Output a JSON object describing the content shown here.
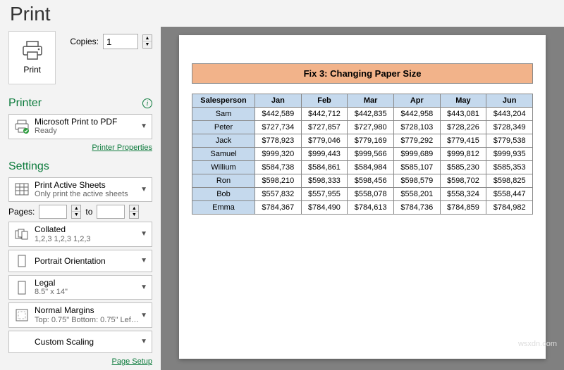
{
  "header": {
    "title": "Print"
  },
  "print_button": {
    "label": "Print"
  },
  "copies": {
    "label": "Copies:",
    "value": "1"
  },
  "printer": {
    "section": "Printer",
    "name": "Microsoft Print to PDF",
    "status": "Ready",
    "properties_link": "Printer Properties"
  },
  "settings": {
    "section": "Settings",
    "print_what": {
      "title": "Print Active Sheets",
      "sub": "Only print the active sheets"
    },
    "pages": {
      "label": "Pages:",
      "to": "to",
      "from": "",
      "until": ""
    },
    "collation": {
      "title": "Collated",
      "sub": "1,2,3   1,2,3   1,2,3"
    },
    "orientation": {
      "title": "Portrait Orientation"
    },
    "paper": {
      "title": "Legal",
      "sub": "8.5\" x 14\""
    },
    "margins": {
      "title": "Normal Margins",
      "sub": "Top: 0.75\" Bottom: 0.75\" Lef…"
    },
    "scaling": {
      "title": "Custom Scaling"
    },
    "page_setup_link": "Page Setup"
  },
  "document": {
    "title": "Fix 3: Changing Paper Size",
    "headers": [
      "Salesperson",
      "Jan",
      "Feb",
      "Mar",
      "Apr",
      "May",
      "Jun"
    ],
    "rows": [
      [
        "Sam",
        "$442,589",
        "$442,712",
        "$442,835",
        "$442,958",
        "$443,081",
        "$443,204"
      ],
      [
        "Peter",
        "$727,734",
        "$727,857",
        "$727,980",
        "$728,103",
        "$728,226",
        "$728,349"
      ],
      [
        "Jack",
        "$778,923",
        "$779,046",
        "$779,169",
        "$779,292",
        "$779,415",
        "$779,538"
      ],
      [
        "Samuel",
        "$999,320",
        "$999,443",
        "$999,566",
        "$999,689",
        "$999,812",
        "$999,935"
      ],
      [
        "Willium",
        "$584,738",
        "$584,861",
        "$584,984",
        "$585,107",
        "$585,230",
        "$585,353"
      ],
      [
        "Ron",
        "$598,210",
        "$598,333",
        "$598,456",
        "$598,579",
        "$598,702",
        "$598,825"
      ],
      [
        "Bob",
        "$557,832",
        "$557,955",
        "$558,078",
        "$558,201",
        "$558,324",
        "$558,447"
      ],
      [
        "Emma",
        "$784,367",
        "$784,490",
        "$784,613",
        "$784,736",
        "$784,859",
        "$784,982"
      ]
    ]
  },
  "watermark": "wsxdn.com",
  "chart_data": {
    "type": "table",
    "title": "Fix 3: Changing Paper Size",
    "columns": [
      "Salesperson",
      "Jan",
      "Feb",
      "Mar",
      "Apr",
      "May",
      "Jun"
    ],
    "rows": [
      {
        "Salesperson": "Sam",
        "Jan": 442589,
        "Feb": 442712,
        "Mar": 442835,
        "Apr": 442958,
        "May": 443081,
        "Jun": 443204
      },
      {
        "Salesperson": "Peter",
        "Jan": 727734,
        "Feb": 727857,
        "Mar": 727980,
        "Apr": 728103,
        "May": 728226,
        "Jun": 728349
      },
      {
        "Salesperson": "Jack",
        "Jan": 778923,
        "Feb": 779046,
        "Mar": 779169,
        "Apr": 779292,
        "May": 779415,
        "Jun": 779538
      },
      {
        "Salesperson": "Samuel",
        "Jan": 999320,
        "Feb": 999443,
        "Mar": 999566,
        "Apr": 999689,
        "May": 999812,
        "Jun": 999935
      },
      {
        "Salesperson": "Willium",
        "Jan": 584738,
        "Feb": 584861,
        "Mar": 584984,
        "Apr": 585107,
        "May": 585230,
        "Jun": 585353
      },
      {
        "Salesperson": "Ron",
        "Jan": 598210,
        "Feb": 598333,
        "Mar": 598456,
        "Apr": 598579,
        "May": 598702,
        "Jun": 598825
      },
      {
        "Salesperson": "Bob",
        "Jan": 557832,
        "Feb": 557955,
        "Mar": 558078,
        "Apr": 558201,
        "May": 558324,
        "Jun": 558447
      },
      {
        "Salesperson": "Emma",
        "Jan": 784367,
        "Feb": 784490,
        "Mar": 784613,
        "Apr": 784736,
        "May": 784859,
        "Jun": 784982
      }
    ]
  }
}
